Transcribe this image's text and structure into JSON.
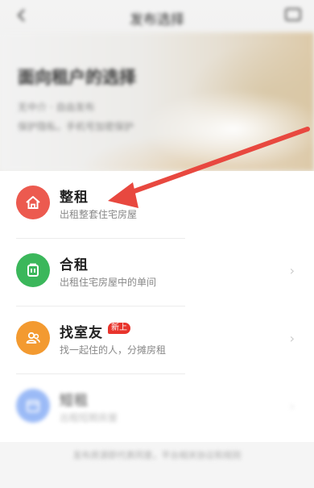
{
  "header": {
    "title": "发布选择",
    "back_icon": "back-arrow-icon",
    "message_icon": "message-icon"
  },
  "hero": {
    "title": "面向租户的选择",
    "tags": "无中介 · 自由发布",
    "subtitle": "保护隐私，手机号加密保护"
  },
  "options": [
    {
      "title": "整租",
      "desc": "出租整套住宅房屋",
      "icon": "home-icon",
      "color": "#ec5a4f"
    },
    {
      "title": "合租",
      "desc": "出租住宅房屋中的单间",
      "icon": "door-icon",
      "color": "#3bb75b"
    },
    {
      "title": "找室友",
      "desc": "找一起住的人，分摊房租",
      "icon": "people-icon",
      "color": "#f39a30",
      "badge": "新上"
    },
    {
      "title": "短租",
      "desc": "出租短期房屋",
      "icon": "calendar-icon",
      "color": "#4a83f0"
    }
  ],
  "footer": {
    "note": "发布房源即代表同意，平台相关协议和规则"
  },
  "colors": {
    "annotation_arrow": "#e8483f",
    "badge": "#e8342c"
  }
}
